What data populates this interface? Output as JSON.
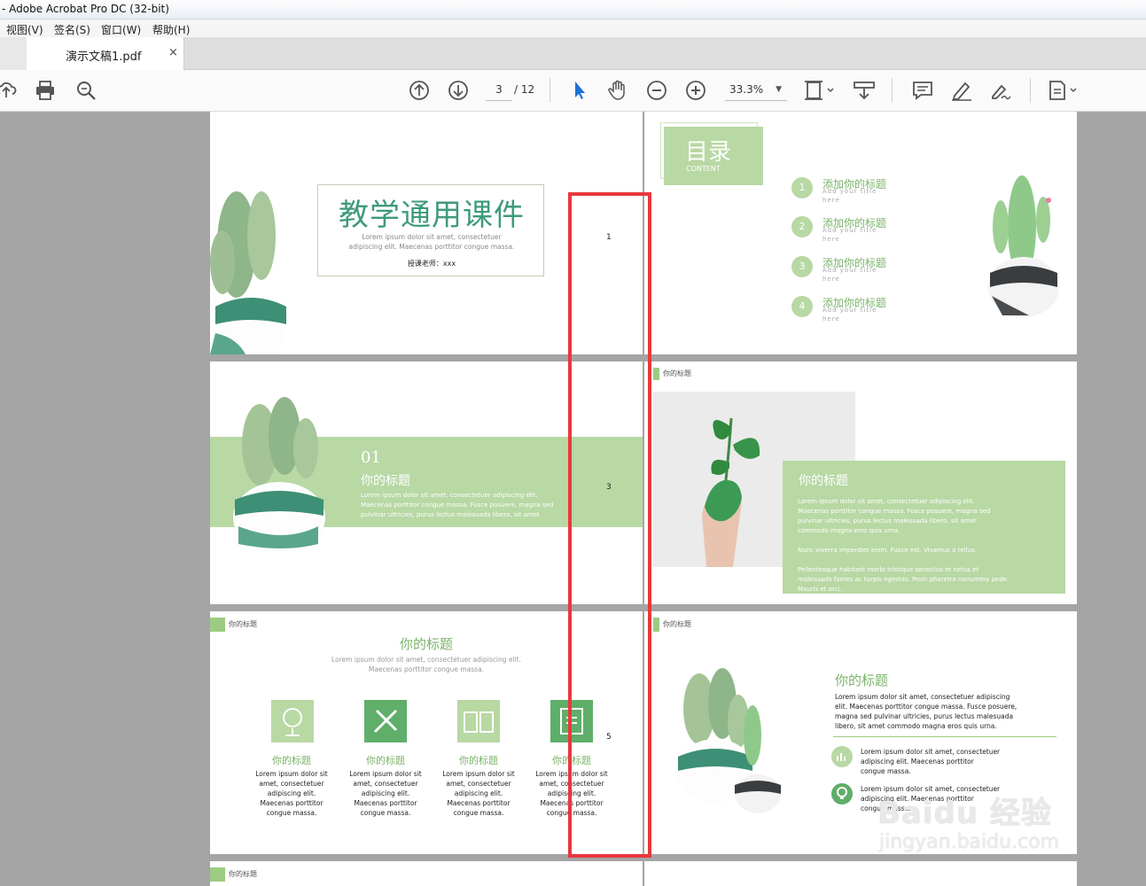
{
  "window": {
    "title": "- Adobe Acrobat Pro DC (32-bit)"
  },
  "menu": [
    "视图(V)",
    "签名(S)",
    "窗口(W)",
    "帮助(H)"
  ],
  "tab": {
    "label": "演示文稿1.pdf",
    "close": "×"
  },
  "toolbar": {
    "current_page": "3",
    "total_pages": "/ 12",
    "zoom": "33.3%",
    "zoom_caret": "▼"
  },
  "icons": {
    "upload": "upload-icon",
    "print": "print-icon",
    "search": "search-icon",
    "prev_page": "arrow-up-circle-icon",
    "next_page": "arrow-down-circle-icon",
    "select": "pointer-arrow-icon",
    "hand": "hand-icon",
    "zoom_out": "zoom-out-icon",
    "zoom_in": "zoom-in-icon",
    "fit": "fit-page-icon",
    "scroll": "scroll-mode-icon",
    "comment": "comment-icon",
    "highlight": "highlight-pen-icon",
    "sign": "sign-icon",
    "export": "export-file-icon"
  },
  "colors": {
    "accent_green": "#b8d8a4",
    "title_green": "#3e9a7b",
    "red_highlight": "#e8383d"
  },
  "slides": {
    "s1": {
      "number": "1",
      "title": "教学通用课件",
      "lorem1": "Lorem ipsum dolor sit amet, consectetuer",
      "lorem2": "adipiscing elit. Maecenas porttitor congue massa.",
      "teacher": "授课老师：xxx"
    },
    "s2": {
      "heading": "目录",
      "sub": "CONTENT",
      "items": [
        {
          "num": "1",
          "title": "添加你的标题",
          "en": "Add your title",
          "en2": "here"
        },
        {
          "num": "2",
          "title": "添加你的标题",
          "en": "Add your title",
          "en2": "here"
        },
        {
          "num": "3",
          "title": "添加你的标题",
          "en": "Add your title",
          "en2": "here"
        },
        {
          "num": "4",
          "title": "添加你的标题",
          "en": "Add your title",
          "en2": "here"
        }
      ]
    },
    "s3": {
      "number": "3",
      "index": "01",
      "title": "你的标题",
      "text1": "Lorem ipsum dolor sit amet, consectetuer adipiscing elit.",
      "text2": "Maecenas porttitor congue massa. Fusce posuere, magna sed",
      "text3": "pulvinar ultricies, purus lectus malesuada libero, sit amet"
    },
    "s4": {
      "tag": "你的标题",
      "title": "你的标题",
      "p1": "Lorem ipsum dolor sit amet, consectetuer adipiscing elit.",
      "p2": "Maecenas porttitor congue massa. Fusce posuere, magna sed",
      "p3": "pulvinar ultricies, purus lectus malesuada libero, sit amet",
      "p4": "commodo magna eros quis urna.",
      "p5": "Nunc viverra imperdiet enim. Fusce est. Vivamus a tellus.",
      "p6": "Pellentesque habitant morbi tristique senectus et netus et",
      "p7": "malesuada fames ac turpis egestas. Proin pharetra nonummy pede.",
      "p8": "Mauris et orci."
    },
    "s5": {
      "number": "5",
      "tag": "你的标题",
      "title": "你的标题",
      "sub1": "Lorem ipsum dolor sit amet, consectetuer adipiscing elit.",
      "sub2": "Maecenas porttitor congue massa.",
      "cols": [
        {
          "title": "你的标题",
          "l1": "Lorem ipsum dolor sit",
          "l2": "amet, consectetuer",
          "l3": "adipiscing elit.",
          "l4": "Maecenas porttitor",
          "l5": "congue massa."
        },
        {
          "title": "你的标题",
          "l1": "Lorem ipsum dolor sit",
          "l2": "amet, consectetuer",
          "l3": "adipiscing elit.",
          "l4": "Maecenas porttitor",
          "l5": "congue massa."
        },
        {
          "title": "你的标题",
          "l1": "Lorem ipsum dolor sit",
          "l2": "amet, consectetuer",
          "l3": "adipiscing elit.",
          "l4": "Maecenas porttitor",
          "l5": "congue massa."
        },
        {
          "title": "你的标题",
          "l1": "Lorem ipsum dolor sit",
          "l2": "amet, consectetuer",
          "l3": "adipiscing elit.",
          "l4": "Maecenas porttitor",
          "l5": "congue massa."
        }
      ]
    },
    "s6": {
      "tag": "你的标题",
      "title": "你的标题",
      "p1": "Lorem ipsum dolor sit amet, consectetuer adipiscing",
      "p2": "elit. Maecenas porttitor congue massa. Fusce posuere,",
      "p3": "magna sed pulvinar ultricies, purus lectus malesuada",
      "p4": "libero, sit amet commodo magna eros quis urna.",
      "b1a": "Lorem ipsum dolor sit amet, consectetuer",
      "b1b": "adipiscing elit. Maecenas porttitor",
      "b1c": "congue massa.",
      "b2a": "Lorem ipsum dolor sit amet, consectetuer",
      "b2b": "adipiscing elit. Maecenas porttitor",
      "b2c": "congue massa."
    },
    "s7": {
      "tag": "你的标题"
    }
  },
  "watermark": {
    "line1": "Baidu 经验",
    "line2": "jingyan.baidu.com"
  }
}
